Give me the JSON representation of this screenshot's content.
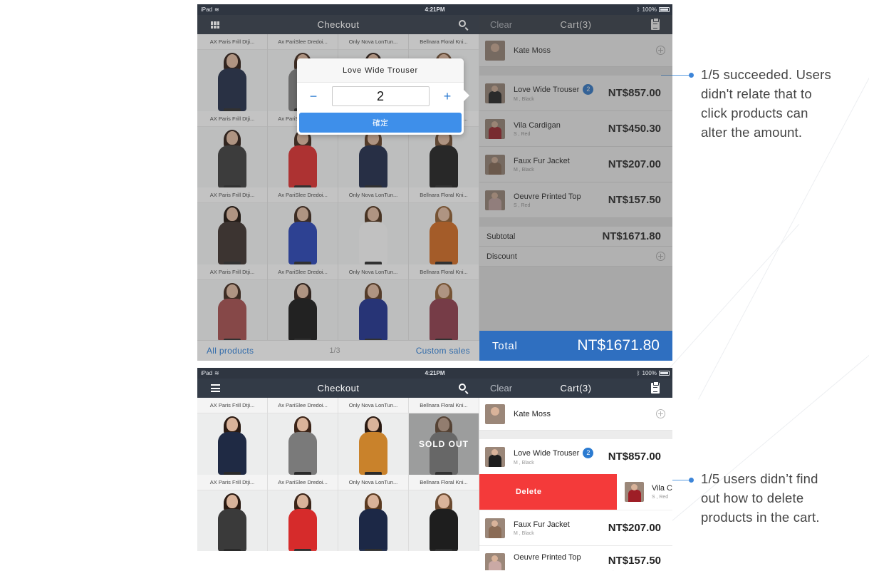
{
  "screen1": {
    "status": {
      "device": "iPad",
      "time": "4:21PM",
      "battery": "100%"
    },
    "nav_title": "Checkout",
    "cart_nav": {
      "clear": "Clear",
      "title": "Cart(3)"
    },
    "products": [
      "AX Paris Frill Dtji...",
      "Ax PariSlee Dredoi...",
      "Only Nova LonTun...",
      "Bellnara Floral Kni...",
      "AX Paris Frill Dtji...",
      "Ax PariSlee Dredoi...",
      "Only Nova LonTun...",
      "Bellnara Floral Kni...",
      "AX Paris Frill Dtji...",
      "Ax PariSlee Dredoi...",
      "Only Nova LonTun...",
      "Bellnara Floral Kni...",
      "AX Paris Frill Dtji...",
      "Ax PariSlee Dredoi...",
      "Only Nova LonTun...",
      "Bellnara Floral Kni..."
    ],
    "bottom": {
      "all": "All products",
      "page": "1/3",
      "custom": "Custom sales"
    },
    "customer": "Kate Moss",
    "items": [
      {
        "name": "Love Wide Trouser",
        "sub": "M , Black",
        "price": "NT$857.00",
        "qty": "2"
      },
      {
        "name": "Vila Cardigan",
        "sub": "S , Red",
        "price": "NT$450.30"
      },
      {
        "name": "Faux Fur Jacket",
        "sub": "M , Black",
        "price": "NT$207.00"
      },
      {
        "name": "Oeuvre Printed Top",
        "sub": "S , Red",
        "price": "NT$157.50"
      }
    ],
    "subtotal_label": "Subtotal",
    "subtotal": "NT$1671.80",
    "discount_label": "Discount",
    "total_label": "Total",
    "total": "NT$1671.80",
    "popup": {
      "title": "Love Wide Trouser",
      "minus": "−",
      "qty": "2",
      "plus": "+",
      "confirm": "確定"
    }
  },
  "screen2": {
    "status": {
      "device": "iPad",
      "time": "4:21PM",
      "battery": "100%"
    },
    "nav_title": "Checkout",
    "cart_nav": {
      "clear": "Clear",
      "title": "Cart(3)"
    },
    "products": [
      "AX Paris Frill Dtji...",
      "Ax PariSlee Dredoi...",
      "Only Nova LonTun...",
      "Bellnara Floral Kni...",
      "AX Paris Frill Dtji...",
      "Ax PariSlee Dredoi...",
      "Only Nova LonTun...",
      "Bellnara Floral Kni..."
    ],
    "sold_out": "SOLD OUT",
    "customer": "Kate Moss",
    "item1": {
      "name": "Love Wide Trouser",
      "sub": "M , Black",
      "price": "NT$857.00",
      "qty": "2"
    },
    "delete": "Delete",
    "swiped": {
      "name": "Vila C",
      "sub": "S , Red"
    },
    "item3": {
      "name": "Faux Fur Jacket",
      "sub": "M , Black",
      "price": "NT$207.00"
    },
    "item4": {
      "name": "Oeuvre Printed Top",
      "price": "NT$157.50"
    }
  },
  "annotations": {
    "a1": [
      "1/5 succeeded. Users",
      "didn't relate that to",
      "click products can",
      "alter the amount."
    ],
    "a2": [
      "1/5 users didn’t find",
      "out how to delete",
      "products in the cart."
    ]
  },
  "colors": {
    "accent": "#2b7bd1",
    "navbar": "#333b47",
    "delete": "#f43a3a",
    "total_bar": "#2f6fc0"
  }
}
